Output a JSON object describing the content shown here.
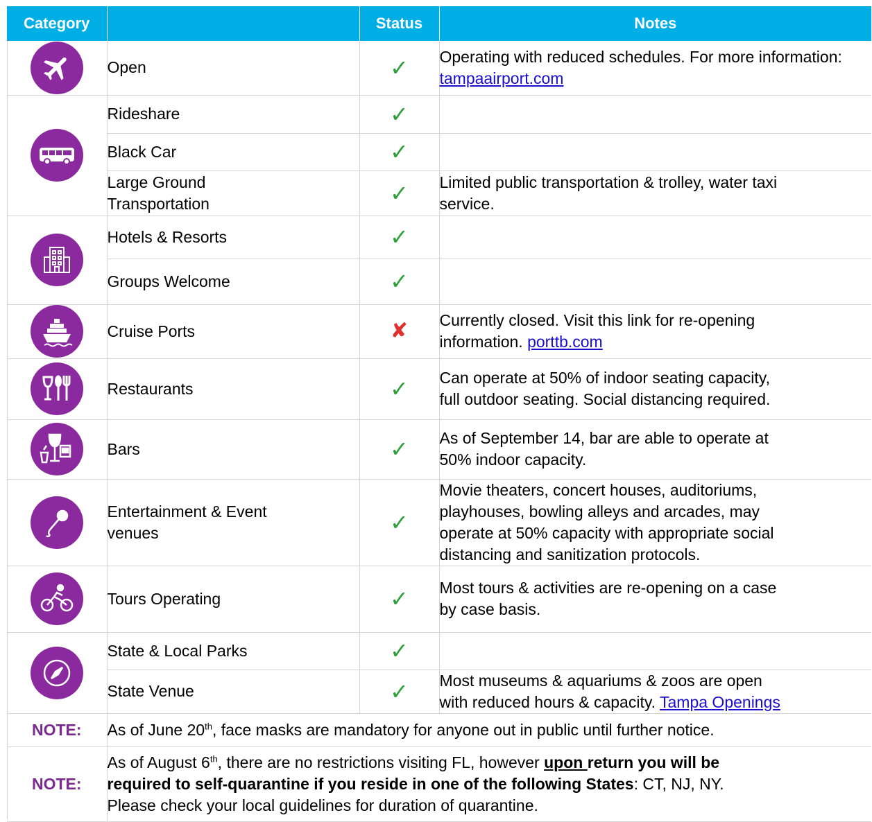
{
  "header": {
    "category": "Category",
    "item": "",
    "status": "Status",
    "notes": "Notes"
  },
  "rows": {
    "airport_open": {
      "item": "Open",
      "status": "check",
      "notes_text": "Operating with reduced schedules. For more information: ",
      "link": "tampaairport.com",
      "icon": "airplane-icon"
    },
    "rideshare": {
      "item": "Rideshare",
      "status": "check",
      "icon": "bus-icon"
    },
    "black_car": {
      "item": "Black Car",
      "status": "check"
    },
    "large_ground_a": {
      "item": "Large Ground",
      "item2": "Transportation",
      "status": "check",
      "notes_a": "Limited public transportation & trolley, water taxi",
      "notes_b": "service."
    },
    "hotels": {
      "item": "Hotels & Resorts",
      "status": "check",
      "icon": "building-icon"
    },
    "groups": {
      "item": "Groups Welcome",
      "status": "check"
    },
    "cruise": {
      "item": "Cruise Ports",
      "status": "cross",
      "notes_a": "Currently closed. Visit this link for re-opening",
      "notes_b": "information. ",
      "link": "porttb.com",
      "icon": "ship-icon"
    },
    "restaurants": {
      "item": "Restaurants",
      "status": "check",
      "notes_a": "Can operate at 50% of indoor seating capacity,",
      "notes_b": "full outdoor seating.  Social distancing required.",
      "icon": "dining-icon"
    },
    "bars": {
      "item": "Bars",
      "status": "check",
      "notes_a": "As of September 14, bar are able to operate at",
      "notes_b": "50% indoor capacity.",
      "icon": "drinks-icon"
    },
    "entertainment": {
      "item": "Entertainment & Event",
      "item2": "venues",
      "status": "check",
      "notes_a": "Movie theaters, concert houses, auditoriums,",
      "notes_b": "playhouses, bowling alleys and arcades, may",
      "notes_c": "operate at 50% capacity with appropriate social",
      "notes_d": "distancing and sanitization protocols.",
      "icon": "microphone-icon"
    },
    "tours": {
      "item": "Tours Operating",
      "status": "check",
      "notes_a": "Most tours & activities are re-opening on a case",
      "notes_b": "by case basis.",
      "icon": "cyclist-icon"
    },
    "parks": {
      "item": "State & Local Parks",
      "status": "check",
      "icon": "compass-icon"
    },
    "state_venue": {
      "item": "State Venue",
      "status": "check",
      "notes_a": "Most museums & aquariums & zoos are open",
      "notes_b": "with reduced hours & capacity. ",
      "link": "Tampa Openings"
    }
  },
  "glyphs": {
    "check": "✓",
    "cross": "✘"
  },
  "note1": {
    "label": "NOTE:",
    "pre": "As of June 20",
    "sup": "th",
    "post": ", face masks are mandatory for anyone out in public until further notice."
  },
  "note2": {
    "label": "NOTE:",
    "pre": "As of August 6",
    "sup": "th",
    "mid": ", there are no restrictions visiting FL, however ",
    "bold_u": "upon ",
    "bold_a": "return you will be",
    "bold_b": "required to self-quarantine if you reside in one of the following States",
    "post_b": ": CT, NJ, NY.",
    "line3": "Please check your local guidelines for duration of quarantine."
  },
  "colors": {
    "header_bg": "#00aee6",
    "icon_circle": "#8a2a9e",
    "check": "#2e9e3a",
    "cross": "#e03030",
    "note_label": "#7a2a8e",
    "link": "#1a0dcc"
  }
}
